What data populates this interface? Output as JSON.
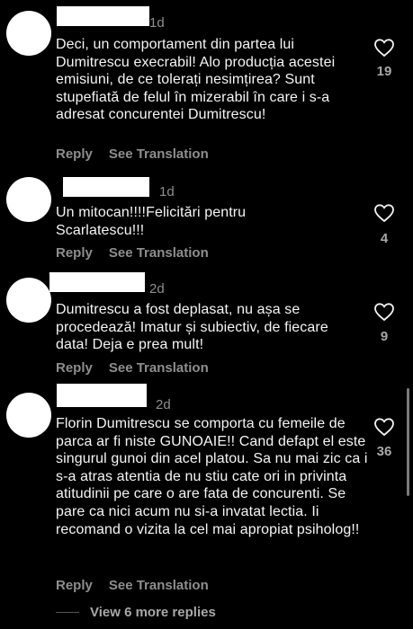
{
  "comments": [
    {
      "time": "1d",
      "text": "Deci, un comportament din partea lui Dumitrescu execrabil! Alo producția acestei emisiuni, de ce tolerați nesimțirea? Sunt stupefiată de felul în mizerabil în care i s-a adresat concurentei Dumitrescu!",
      "likes": "19",
      "reply": "Reply",
      "translate": "See Translation"
    },
    {
      "time": "1d",
      "text": "Un mitocan!!!!Felicitări pentru Scarlatescu!!!",
      "likes": "4",
      "reply": "Reply",
      "translate": "See Translation"
    },
    {
      "time": "2d",
      "text": "Dumitrescu a fost deplasat, nu așa se procedează! Imatur și subiectiv, de fiecare data! Deja e prea mult!",
      "likes": "9",
      "reply": "Reply",
      "translate": "See Translation"
    },
    {
      "time": "2d",
      "text": "Florin Dumitrescu se comporta cu femeile de parca ar fi niste GUNOAIE!! Cand defapt el este singurul gunoi din acel platou. Sa nu mai zic ca i s-a atras atentia de nu stiu cate ori in privinta atitudinii pe care o are fata de concurenti. Se pare ca nici acum nu si-a invatat lectia. Ii recomand o vizita la cel mai apropiat psiholog!!",
      "likes": "36",
      "reply": "Reply",
      "translate": "See Translation"
    }
  ],
  "view_more": "View 6 more replies",
  "icons": {
    "like": "heart-outline-icon"
  },
  "colors": {
    "background": "#000000",
    "text": "#f5f5f5",
    "muted": "#8e8e8e"
  }
}
